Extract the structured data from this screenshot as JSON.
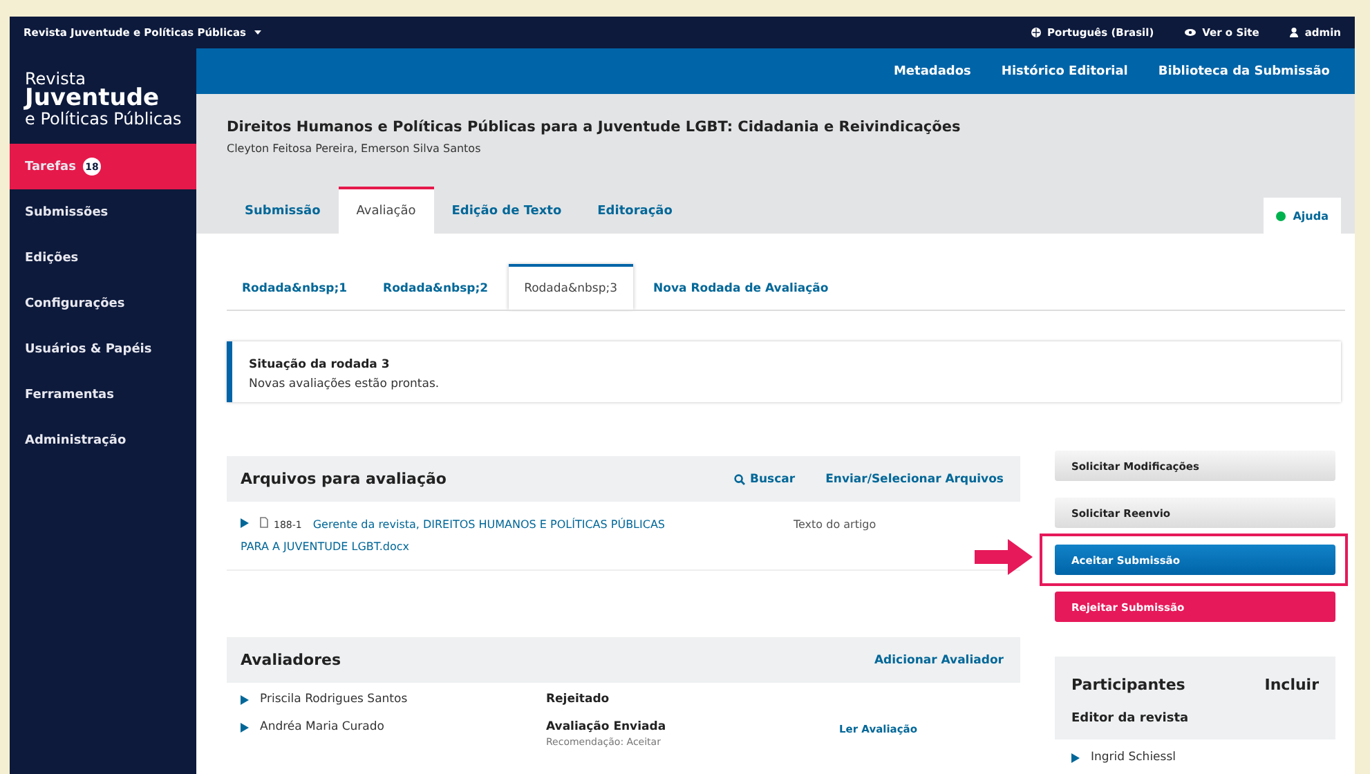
{
  "top_bar": {
    "journal": "Revista Juventude e Políticas Públicas",
    "language": "Português (Brasil)",
    "view_site": "Ver o Site",
    "user": "admin"
  },
  "sidebar": {
    "logo": {
      "line_1": "Revista",
      "line_2": "Juventude",
      "line_3": "e Políticas Públicas"
    },
    "items": [
      {
        "label": "Tarefas",
        "badge": "18",
        "selected": true
      },
      {
        "label": "Submissões",
        "selected": false
      },
      {
        "label": "Edições",
        "selected": false
      },
      {
        "label": "Configurações",
        "selected": false
      },
      {
        "label": "Usuários & Papéis",
        "selected": false
      },
      {
        "label": "Ferramentas",
        "selected": false
      },
      {
        "label": "Administração",
        "selected": false
      }
    ]
  },
  "header_links": [
    "Metadados",
    "Histórico Editorial",
    "Biblioteca da Submissão"
  ],
  "submission": {
    "title": "Direitos Humanos e Políticas Públicas para a Juventude LGBT: Cidadania e Reivindicações",
    "authors": "Cleyton Feitosa Pereira, Emerson Silva Santos"
  },
  "stage_tabs": [
    {
      "label": "Submissão",
      "selected": false
    },
    {
      "label": "Avaliação",
      "selected": true
    },
    {
      "label": "Edição de Texto",
      "selected": false
    },
    {
      "label": "Editoração",
      "selected": false
    }
  ],
  "help": "Ajuda",
  "round_tabs": [
    {
      "label": "Rodada&nbsp;1",
      "selected": false
    },
    {
      "label": "Rodada&nbsp;2",
      "selected": false
    },
    {
      "label": "Rodada&nbsp;3",
      "selected": true
    },
    {
      "label": "Nova Rodada de Avaliação",
      "selected": false
    }
  ],
  "round_status": {
    "title": "Situação da rodada 3",
    "text": "Novas avaliações estão prontas."
  },
  "files": {
    "title": "Arquivos para avaliação",
    "search": "Buscar",
    "upload": "Enviar/Selecionar Arquivos",
    "rows": [
      {
        "id": "188-1",
        "name_lines": [
          "Gerente da revista, DIREITOS HUMANOS E POLÍTICAS PÚBLICAS",
          "PARA A JUVENTUDE LGBT.docx"
        ],
        "type": "Texto do artigo"
      }
    ]
  },
  "reviewers": {
    "title": "Avaliadores",
    "action": "Adicionar Avaliador",
    "rows": [
      {
        "name": "Priscila Rodrigues Santos",
        "status": "Rejeitado"
      },
      {
        "name": "Andréa Maria Curado",
        "status": "Avaliação Enviada",
        "note": "Recomendação: Aceitar",
        "action": "Ler Avaliação"
      }
    ]
  },
  "decision_buttons": [
    {
      "label": "Solicitar Modificações",
      "kind": "default",
      "highlighted": false
    },
    {
      "label": "Solicitar Reenvio",
      "kind": "default",
      "highlighted": false
    },
    {
      "label": "Aceitar Submissão",
      "kind": "primary",
      "highlighted": true
    },
    {
      "label": "Rejeitar Submissão",
      "kind": "danger",
      "highlighted": false
    }
  ],
  "participants": {
    "title": "Participantes",
    "action": "Incluir",
    "groups": [
      {
        "role": "Editor da revista",
        "members": [
          "Ingrid Schiessl"
        ]
      }
    ]
  }
}
